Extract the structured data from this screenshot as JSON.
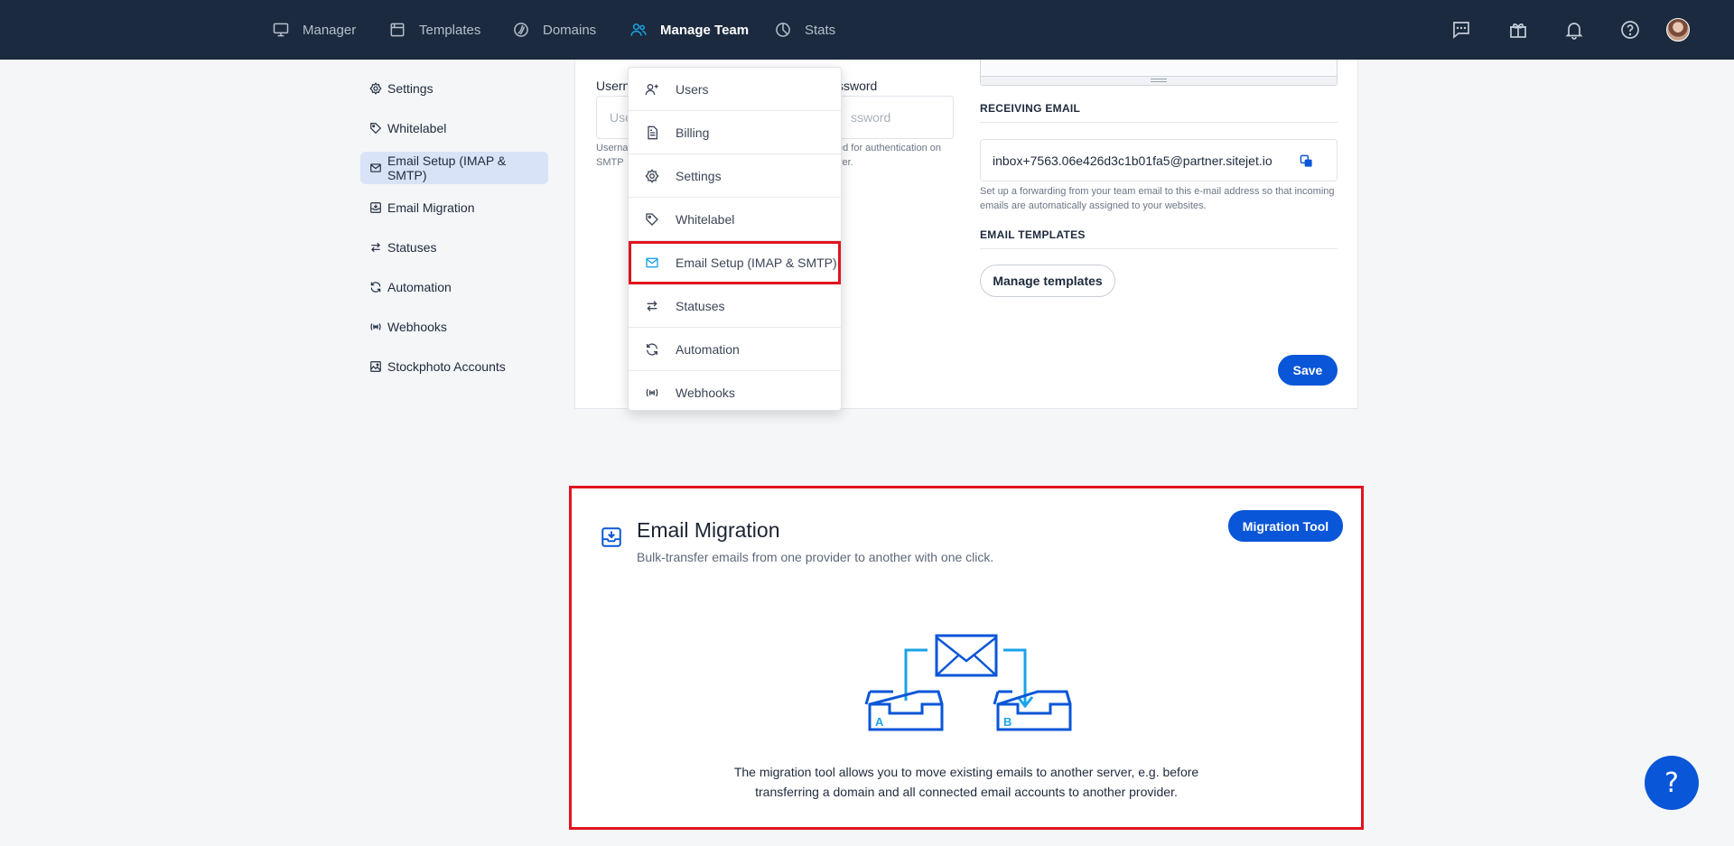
{
  "nav": {
    "items": [
      {
        "label": "Manager",
        "icon": "monitor-icon"
      },
      {
        "label": "Templates",
        "icon": "browser-window-icon"
      },
      {
        "label": "Domains",
        "icon": "domain-globe-icon"
      },
      {
        "label": "Manage Team",
        "icon": "users-icon",
        "active": true
      },
      {
        "label": "Stats",
        "icon": "pie-chart-icon"
      }
    ],
    "right_icons": [
      "chat-icon",
      "gift-icon",
      "bell-icon",
      "help-circle-icon",
      "avatar"
    ]
  },
  "sidebar": {
    "items": [
      {
        "label": "Settings",
        "icon": "gear-icon"
      },
      {
        "label": "Whitelabel",
        "icon": "tag-icon"
      },
      {
        "label": "Email Setup (IMAP & SMTP)",
        "icon": "mail-icon",
        "active": true
      },
      {
        "label": "Email Migration",
        "icon": "inbox-download-icon"
      },
      {
        "label": "Statuses",
        "icon": "swap-arrows-icon"
      },
      {
        "label": "Automation",
        "icon": "refresh-icon"
      },
      {
        "label": "Webhooks",
        "icon": "webhook-icon"
      },
      {
        "label": "Stockphoto Accounts",
        "icon": "image-icon"
      }
    ]
  },
  "smtp": {
    "username_label": "Usern",
    "username_placeholder": "Use",
    "password_label": "ssword",
    "password_placeholder": "ssword",
    "hint_line1_left": "Userna",
    "hint_line1_right": "ed for authentication on",
    "hint_line2_left": "SMTP",
    "hint_line2_right": "ver."
  },
  "receiving": {
    "title": "RECEIVING EMAIL",
    "address": "inbox+7563.06e426d3c1b01fa5@partner.sitejet.io",
    "hint": "Set up a forwarding from your team email to this e-mail address so that incoming emails are automatically assigned to your websites."
  },
  "email_templates": {
    "title": "EMAIL TEMPLATES",
    "button": "Manage templates"
  },
  "save_label": "Save",
  "dropdown": {
    "items": [
      {
        "label": "Users",
        "icon": "user-plus-icon"
      },
      {
        "label": "Billing",
        "icon": "document-icon"
      },
      {
        "label": "Settings",
        "icon": "gear-icon"
      },
      {
        "label": "Whitelabel",
        "icon": "tag-icon"
      },
      {
        "label": "Email Setup (IMAP & SMTP)",
        "icon": "mail-icon",
        "highlighted": true
      },
      {
        "label": "Statuses",
        "icon": "swap-arrows-icon"
      },
      {
        "label": "Automation",
        "icon": "refresh-icon"
      },
      {
        "label": "Webhooks",
        "icon": "webhook-icon"
      }
    ]
  },
  "migration": {
    "title": "Email Migration",
    "subtitle": "Bulk-transfer emails from one provider to another with one click.",
    "button": "Migration Tool",
    "tray_a": "A",
    "tray_b": "B",
    "description_line1": "The migration tool allows you to move existing emails to another server, e.g. before",
    "description_line2": "transferring a domain and all connected email accounts to another provider."
  },
  "help_fab": "?",
  "colors": {
    "topbar": "#1b2a3e",
    "primary": "#0a56d8",
    "highlight_red": "#e0141e",
    "accent_cyan": "#1aa3e8"
  }
}
